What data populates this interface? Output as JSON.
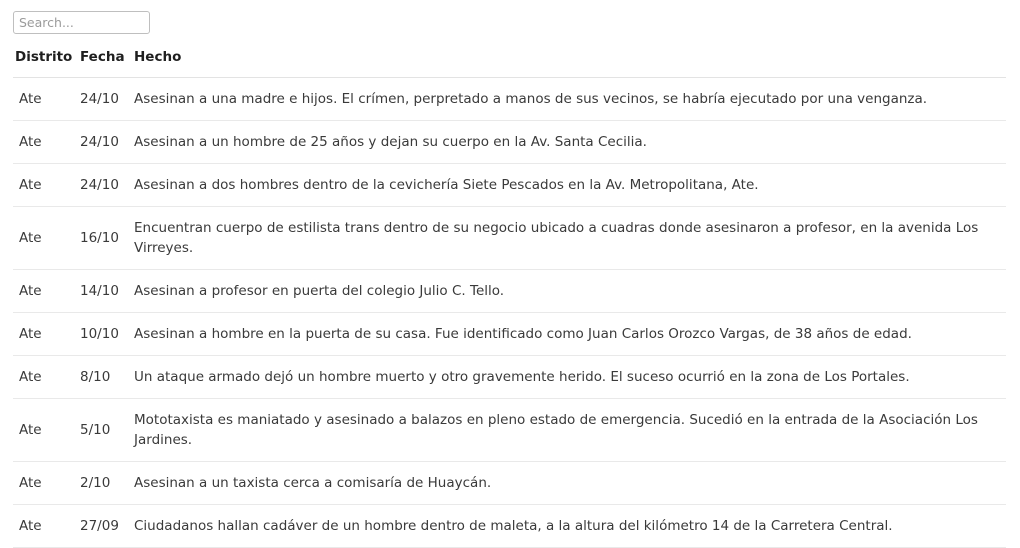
{
  "search": {
    "placeholder": "Search...",
    "value": ""
  },
  "table": {
    "columns": [
      {
        "key": "distrito",
        "label": "Distrito"
      },
      {
        "key": "fecha",
        "label": "Fecha"
      },
      {
        "key": "hecho",
        "label": "Hecho"
      }
    ],
    "rows": [
      {
        "distrito": "Ate",
        "fecha": "24/10",
        "hecho": "Asesinan a una madre e hijos. El crímen, perpretado a manos de sus vecinos, se habría ejecutado por una venganza."
      },
      {
        "distrito": "Ate",
        "fecha": "24/10",
        "hecho": "Asesinan a un hombre de 25 años y dejan su cuerpo en la Av. Santa Cecilia."
      },
      {
        "distrito": "Ate",
        "fecha": "24/10",
        "hecho": "Asesinan a dos hombres dentro de la cevichería Siete Pescados en la Av. Metropolitana, Ate."
      },
      {
        "distrito": "Ate",
        "fecha": "16/10",
        "hecho": "Encuentran cuerpo de estilista trans dentro de su negocio ubicado a cuadras donde asesinaron a profesor, en la avenida Los Virreyes."
      },
      {
        "distrito": "Ate",
        "fecha": "14/10",
        "hecho": "Asesinan a profesor en puerta del colegio Julio C. Tello."
      },
      {
        "distrito": "Ate",
        "fecha": "10/10",
        "hecho": "Asesinan a hombre en la puerta de su casa. Fue identificado como Juan Carlos Orozco Vargas, de 38 años de edad."
      },
      {
        "distrito": "Ate",
        "fecha": "8/10",
        "hecho": "Un ataque armado dejó un hombre muerto y otro gravemente herido. El suceso ocurrió en la zona de Los Portales."
      },
      {
        "distrito": "Ate",
        "fecha": "5/10",
        "hecho": "Mototaxista es maniatado y asesinado a balazos en pleno estado de emergencia. Sucedió en la entrada de la Asociación Los Jardines."
      },
      {
        "distrito": "Ate",
        "fecha": "2/10",
        "hecho": "Asesinan a un taxista cerca a comisaría de Huaycán."
      },
      {
        "distrito": "Ate",
        "fecha": "27/09",
        "hecho": "Ciudadanos hallan cadáver de un hombre dentro de maleta, a la altura del kilómetro 14 de la Carretera Central."
      }
    ]
  },
  "colors": {
    "background": "#ffffff",
    "text": "#333333",
    "header_text": "#1f1f1f",
    "divider": "#e9e9e9",
    "input_border": "#bfbfbf",
    "placeholder": "#9b9b9b"
  }
}
